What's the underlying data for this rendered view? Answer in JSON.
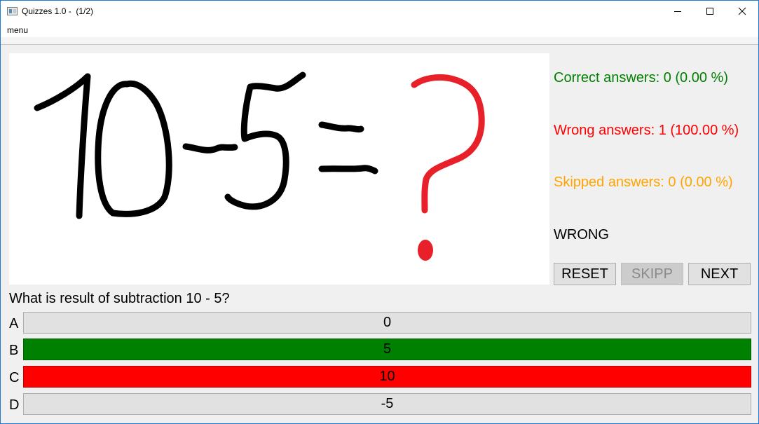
{
  "window": {
    "title": "Quizzes 1.0 -  (1/2)",
    "menu_label": "menu"
  },
  "image": {
    "caption_text": "10-5=?",
    "colors": {
      "expression": "#000000",
      "question_mark": "#e8202a"
    }
  },
  "stats": {
    "correct": "Correct answers: 0 (0.00 %)",
    "wrong": "Wrong answers: 1 (100.00 %)",
    "skipped": "Skipped answers: 0 (0.00 %)",
    "colors": {
      "correct": "#008000",
      "wrong": "#ff0000",
      "skipped": "#ffa500"
    }
  },
  "status": "WRONG",
  "controls": {
    "reset": "RESET",
    "skipp": "SKIPP",
    "next": "NEXT",
    "skipp_enabled": false
  },
  "question": "What is result of subtraction 10 - 5?",
  "options": [
    {
      "letter": "A",
      "value": "0",
      "state": "neutral"
    },
    {
      "letter": "B",
      "value": "5",
      "state": "correct"
    },
    {
      "letter": "C",
      "value": "10",
      "state": "wrong"
    },
    {
      "letter": "D",
      "value": "-5",
      "state": "neutral"
    }
  ],
  "icons": [
    "app-window-icon",
    "minimize-icon",
    "maximize-icon",
    "close-icon"
  ]
}
